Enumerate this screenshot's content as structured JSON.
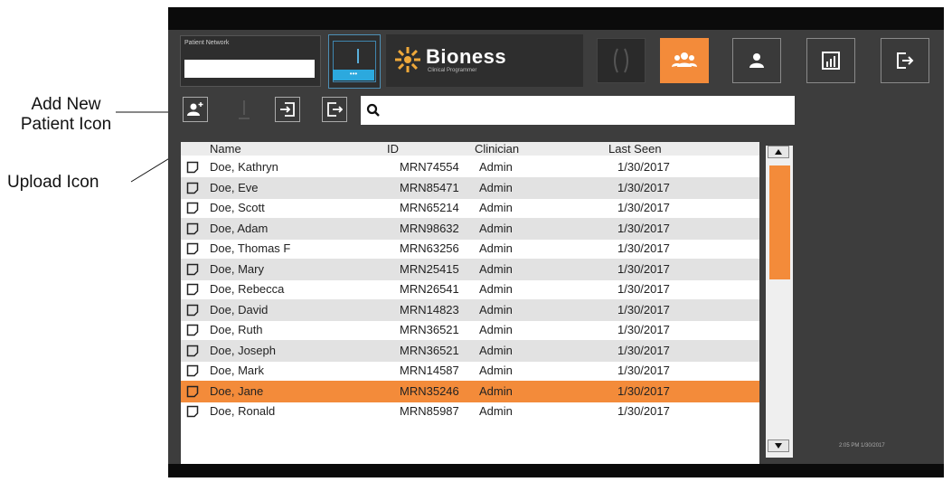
{
  "annotations": {
    "add_new_patient": "Add New\nPatient Icon",
    "add_new_patient_line1": "Add New",
    "add_new_patient_line2": "Patient Icon",
    "upload": "Upload Icon"
  },
  "header": {
    "patient_network_label": "Patient Network",
    "patient_network_value": "",
    "device_button_label": "•••",
    "logo_name": "Bioness",
    "logo_tagline": "Clinical Programmer",
    "nav": [
      {
        "icon": "handles-icon",
        "state": "disabled"
      },
      {
        "icon": "patients-group-icon",
        "state": "active"
      },
      {
        "icon": "user-icon",
        "state": "normal"
      },
      {
        "icon": "reports-chart-icon",
        "state": "normal"
      },
      {
        "icon": "logout-icon",
        "state": "normal"
      }
    ]
  },
  "toolbar": {
    "tools": [
      "add-new-patient-icon",
      "upload-icon",
      "import-icon",
      "export-icon"
    ],
    "search_placeholder": "",
    "search_value": ""
  },
  "table": {
    "columns": [
      "Name",
      "ID",
      "Clinician",
      "Last Seen"
    ],
    "rows": [
      {
        "name": "Doe, Kathryn",
        "id": "MRN74554",
        "clinician": "Admin",
        "last_seen": "1/30/2017"
      },
      {
        "name": "Doe, Eve",
        "id": "MRN85471",
        "clinician": "Admin",
        "last_seen": "1/30/2017"
      },
      {
        "name": "Doe, Scott",
        "id": "MRN65214",
        "clinician": "Admin",
        "last_seen": "1/30/2017"
      },
      {
        "name": "Doe, Adam",
        "id": "MRN98632",
        "clinician": "Admin",
        "last_seen": "1/30/2017"
      },
      {
        "name": "Doe, Thomas F",
        "id": "MRN63256",
        "clinician": "Admin",
        "last_seen": "1/30/2017"
      },
      {
        "name": "Doe, Mary",
        "id": "MRN25415",
        "clinician": "Admin",
        "last_seen": "1/30/2017"
      },
      {
        "name": "Doe, Rebecca",
        "id": "MRN26541",
        "clinician": "Admin",
        "last_seen": "1/30/2017"
      },
      {
        "name": "Doe, David",
        "id": "MRN14823",
        "clinician": "Admin",
        "last_seen": "1/30/2017"
      },
      {
        "name": "Doe, Ruth",
        "id": "MRN36521",
        "clinician": "Admin",
        "last_seen": "1/30/2017"
      },
      {
        "name": "Doe, Joseph",
        "id": "MRN36521",
        "clinician": "Admin",
        "last_seen": "1/30/2017"
      },
      {
        "name": "Doe, Mark",
        "id": "MRN14587",
        "clinician": "Admin",
        "last_seen": "1/30/2017"
      },
      {
        "name": "Doe, Jane",
        "id": "MRN35246",
        "clinician": "Admin",
        "last_seen": "1/30/2017",
        "selected": true
      },
      {
        "name": "Doe, Ronald",
        "id": "MRN85987",
        "clinician": "Admin",
        "last_seen": "1/30/2017"
      }
    ]
  },
  "status": {
    "timestamp": "2:05 PM 1/30/2017"
  },
  "colors": {
    "accent": "#f38b3a",
    "device_blue": "#2ca9de",
    "background": "#3d3d3d",
    "row_alt": "#e2e2e2"
  }
}
